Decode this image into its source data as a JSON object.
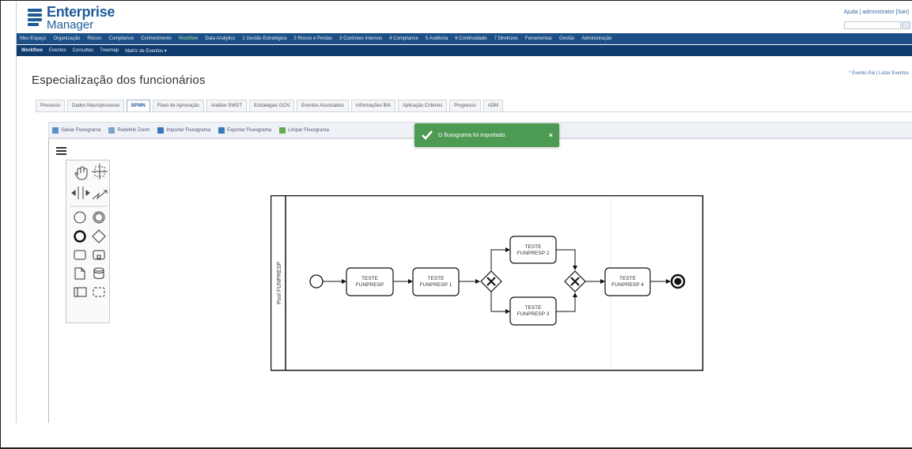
{
  "header": {
    "brand_line1": "Enterprise",
    "brand_line2": "Manager",
    "user_links": "Ajuda | administrator [Sair]"
  },
  "main_nav": [
    "Meu Espaço",
    "Organização",
    "Riscos",
    "Compliance",
    "Conhecimento",
    "Workflow",
    "Data Analytics",
    "1 Gestão Estratégica",
    "2 Riscos e Perdas",
    "3 Controles Internos",
    "4 Compliance",
    "5 Auditoria",
    "6 Continuidade",
    "7 Diretrizes",
    "Ferramentas",
    "Gestão",
    "Administração"
  ],
  "main_nav_active": "Workflow",
  "sub_nav": [
    "Workflow",
    "Eventos",
    "Consultas",
    "Treemap",
    "Matriz de Eventos ▾"
  ],
  "page": {
    "title": "Especialização dos funcionários",
    "links": "* Evento Pai | Listar Eventos"
  },
  "tabs": [
    "Processo",
    "Dados Macroprocesso",
    "BPMN",
    "Fluxo de Aprovação",
    "Análise SWOT",
    "Estratégias GCN",
    "Eventos Associados",
    "Informações BIA",
    "Aplicação Critérios",
    "Progresso",
    "ADM"
  ],
  "active_tab": "BPMN",
  "toolbar": [
    {
      "label": "Salvar Fluxograma",
      "icon": "save-icon",
      "color": "#5b8fc7"
    },
    {
      "label": "Redefinir Zoom",
      "icon": "zoom-reset-icon",
      "color": "#7da2c9"
    },
    {
      "label": "Importar Fluxograma",
      "icon": "import-icon",
      "color": "#3b78b8"
    },
    {
      "label": "Exportar Fluxograma",
      "icon": "export-icon",
      "color": "#3b78b8"
    },
    {
      "label": "Limpar Fluxograma",
      "icon": "clear-icon",
      "color": "#6aa84f"
    }
  ],
  "toast": {
    "message": "O fluxograma foi importado.",
    "close": "×",
    "color": "#4d9a53"
  },
  "diagram": {
    "pool_label": "Pool FUNPRESP",
    "tasks": {
      "t0": [
        "TESTE",
        "FUNPRESP"
      ],
      "t1": [
        "TESTE",
        "FUNPRESP 1"
      ],
      "t2": [
        "TESTE",
        "FUNPRESP 2"
      ],
      "t3": [
        "TESTE",
        "FUNPRESP 3"
      ],
      "t4": [
        "TESTE",
        "FUNPRESP 4"
      ]
    }
  },
  "palette_tools": [
    "hand-tool-icon",
    "lasso-tool-icon",
    "space-tool-icon",
    "connect-tool-icon",
    "start-event-icon",
    "intermediate-event-icon",
    "end-event-icon",
    "gateway-icon",
    "task-icon",
    "subprocess-icon",
    "data-object-icon",
    "data-store-icon",
    "pool-icon",
    "group-icon"
  ]
}
